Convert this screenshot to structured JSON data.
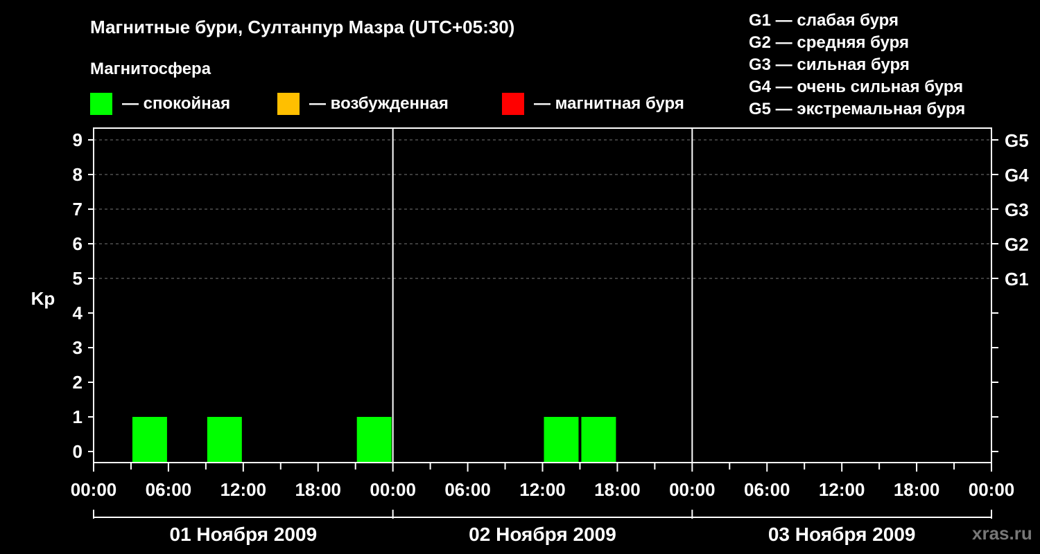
{
  "title": "Магнитные бури, Султанпур Мазра (UTC+05:30)",
  "subtitle": "Магнитосфера",
  "legend": [
    {
      "label": "— спокойная",
      "color": "#00ff00"
    },
    {
      "label": "— возбужденная",
      "color": "#ffbf00"
    },
    {
      "label": "— магнитная буря",
      "color": "#ff0000"
    }
  ],
  "g_legend": [
    "G1 — слабая буря",
    "G2 — средняя буря",
    "G3 — сильная буря",
    "G4 — очень сильная буря",
    "G5 — экстремальная буря"
  ],
  "watermark": "xras.ru",
  "chart_data": {
    "type": "bar",
    "ylabel": "Kp",
    "ylim": [
      0,
      9
    ],
    "y_ticks": [
      0,
      1,
      2,
      3,
      4,
      5,
      6,
      7,
      8,
      9
    ],
    "g_levels": [
      {
        "label": "G1",
        "kp": 5
      },
      {
        "label": "G2",
        "kp": 6
      },
      {
        "label": "G3",
        "kp": 7
      },
      {
        "label": "G4",
        "kp": 8
      },
      {
        "label": "G5",
        "kp": 9
      }
    ],
    "x_range_hours": [
      0,
      72
    ],
    "x_tick_labels": [
      "00:00",
      "06:00",
      "12:00",
      "18:00",
      "00:00",
      "06:00",
      "12:00",
      "18:00",
      "00:00",
      "06:00",
      "12:00",
      "18:00",
      "00:00"
    ],
    "days": [
      "01 Ноября 2009",
      "02 Ноября 2009",
      "03 Ноября 2009"
    ],
    "series": [
      {
        "status_color": "#00ff00",
        "bars": [
          {
            "start_hour": 3,
            "end_hour": 6,
            "kp": 1
          },
          {
            "start_hour": 9,
            "end_hour": 12,
            "kp": 1
          },
          {
            "start_hour": 21,
            "end_hour": 24,
            "kp": 1
          },
          {
            "start_hour": 36,
            "end_hour": 39,
            "kp": 1
          },
          {
            "start_hour": 39,
            "end_hour": 42,
            "kp": 1
          }
        ]
      }
    ]
  }
}
